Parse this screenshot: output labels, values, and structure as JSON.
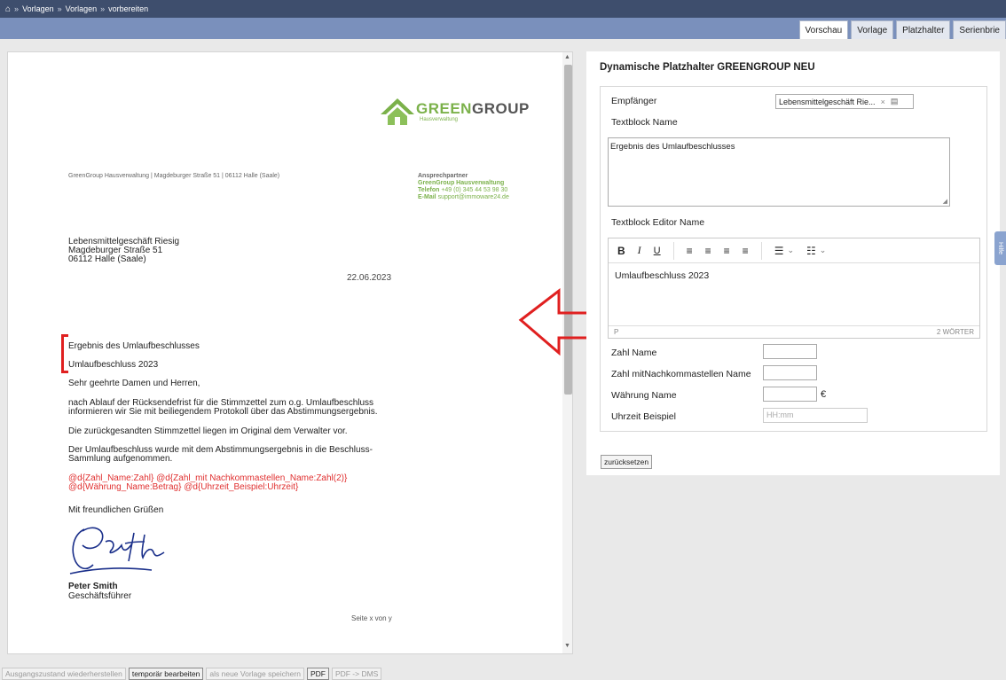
{
  "breadcrumb": {
    "items": [
      "Vorlagen",
      "Vorlagen",
      "vorbereiten"
    ]
  },
  "tabs": [
    "Vorschau",
    "Vorlage",
    "Platzhalter",
    "Serienbrie"
  ],
  "logo": {
    "name_part1": "GREEN",
    "name_part2": "GROUP",
    "subtitle": "Hausverwaltung"
  },
  "letter": {
    "sender_line": "GreenGroup Hausverwaltung | Magdeburger Straße 51 | 06112 Halle (Saale)",
    "contact": {
      "heading": "Ansprechpartner",
      "company": "GreenGroup Hausverwaltung",
      "phone_label": "Telefon",
      "phone": "+49 (0) 345 44 53 98 30",
      "mail_label": "E-Mail",
      "mail": "support@immoware24.de"
    },
    "recipient": [
      "Lebensmittelgeschäft Riesig",
      "Magdeburger Straße 51",
      "06112 Halle (Saale)"
    ],
    "date": "22.06.2023",
    "subject": "Ergebnis des Umlaufbeschlusses",
    "subject2": "Umlaufbeschluss 2023",
    "salutation": "Sehr geehrte Damen und Herren,",
    "para1": [
      "nach Ablauf der Rücksendefrist für die Stimmzettel zum o.g. Umlaufbeschluss",
      "informieren wir Sie mit beiliegendem Protokoll über das Abstimmungsergebnis."
    ],
    "para2": "Die zurückgesandten Stimmzettel liegen im Original dem Verwalter vor.",
    "para3": [
      "Der Umlaufbeschluss wurde mit dem Abstimmungsergebnis in die Beschluss-",
      "Sammlung aufgenommen."
    ],
    "placeholders": [
      "@d{Zahl_Name:Zahl} @d{Zahl_mit Nachkommastellen_Name:Zahl(2)}",
      "@d{Währung_Name:Betrag} @d{Uhrzeit_Beispiel:Uhrzeit}"
    ],
    "closing": "Mit freundlichen Grüßen",
    "signer_name": "Peter Smith",
    "signer_role": "Geschäftsführer",
    "page_label": "Seite x von y"
  },
  "panel": {
    "title": "Dynamische Platzhalter GREENGROUP NEU",
    "recipient_label": "Empfänger",
    "recipient_value": "Lebensmittelgeschäft Rie...",
    "textblock_label": "Textblock Name",
    "textblock_value": "Ergebnis des Umlaufbeschlusses",
    "editor_label": "Textblock Editor Name",
    "editor_content": "Umlaufbeschluss 2023",
    "editor_path": "P",
    "editor_wordcount": "2 WÖRTER",
    "zahl_label": "Zahl Name",
    "zahl2_label": "Zahl mitNachkommastellen Name",
    "waehrung_label": "Währung Name",
    "currency_symbol": "€",
    "uhrzeit_label": "Uhrzeit Beispiel",
    "uhrzeit_placeholder": "HH:mm",
    "reset_button": "zurücksetzen"
  },
  "side_tab": "Hilfe",
  "bottom_buttons": [
    "Ausgangszustand wiederherstellen",
    "temporär bearbeiten",
    "als neue Vorlage speichern",
    "PDF",
    "PDF -> DMS"
  ]
}
